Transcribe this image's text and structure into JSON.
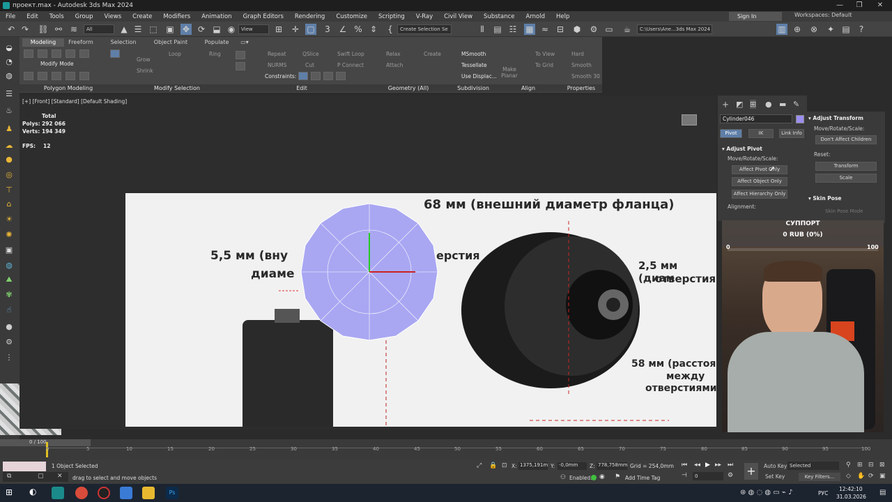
{
  "window": {
    "title": "проект.max - Autodesk 3ds Max 2024",
    "minimize": "—",
    "maximize": "❐",
    "close": "✕"
  },
  "menu": [
    "File",
    "Edit",
    "Tools",
    "Group",
    "Views",
    "Create",
    "Modifiers",
    "Animation",
    "Graph Editors",
    "Rendering",
    "Customize",
    "Scripting",
    "V-Ray",
    "Civil View",
    "Substance",
    "Arnold",
    "Help"
  ],
  "account": {
    "signin": "Sign In",
    "workspaces": "Workspaces: Default"
  },
  "toolbar": {
    "filter": "All",
    "view": "View",
    "selection_set": "Create Selection Se",
    "path": "C:\\Users\\Ane...3ds Max 2024"
  },
  "ribbon": {
    "tabs": [
      "Modeling",
      "Freeform",
      "Selection",
      "Object Paint",
      "Populate"
    ],
    "mode": "Modify Mode",
    "groups": [
      "Polygon Modeling",
      "Modify Selection",
      "Edit",
      "Geometry (All)",
      "Subdivision",
      "Align",
      "Properties"
    ],
    "items": {
      "grow": "Grow",
      "shrink": "Shrink",
      "loop": "Loop",
      "ring": "Ring",
      "repeat": "Repeat",
      "qslice": "QSlice",
      "swift_loop": "Swift Loop",
      "nurms": "NURMS",
      "cut": "Cut",
      "p_connect": "P Connect",
      "constraints": "Constraints:",
      "relax": "Relax",
      "create": "Create",
      "attach": "Attach",
      "msmooth": "MSmooth",
      "tessellate": "Tessellate",
      "use_displace": "Use Displac...",
      "make_planar": "Make Planar",
      "to_view": "To View",
      "to_grid": "To Grid",
      "hard": "Hard",
      "smooth": "Smooth",
      "smooth30": "Smooth 30"
    }
  },
  "viewport": {
    "label": "[+] [Front] [Standard] [Default Shading]",
    "stats": {
      "total": "Total",
      "polys_label": "Polys:",
      "polys": "292 066",
      "verts_label": "Verts:",
      "verts": "194 349",
      "fps_label": "FPS:",
      "fps": "12"
    }
  },
  "image_text": {
    "flange": "68 мм (внешний диаметр фланца)",
    "inner1": "5,5 мм (вну",
    "inner2": "диаме",
    "hole_word": "ерстия",
    "hole_d1": "2,5 мм (диам",
    "hole_d2": "отверстия",
    "dist1": "58 мм (расстоя",
    "dist2": "между",
    "dist3": "отверстиями"
  },
  "command_panel": {
    "object_name": "Cylinder046",
    "object_color": "#9b8ef0",
    "tabs": [
      "Pivot",
      "IK",
      "Link Info"
    ],
    "adjust_pivot": "Adjust Pivot",
    "move_rotate_scale": "Move/Rotate/Scale:",
    "buttons": [
      "Affect Pivot Only",
      "Affect Object Only",
      "Affect Hierarchy Only"
    ],
    "alignment": "Alignment:"
  },
  "rollout": {
    "adjust_transform": "Adjust Transform",
    "move_rotate_scale": "Move/Rotate/Scale:",
    "dont_affect": "Don't Affect Children",
    "reset": "Reset:",
    "transform": "Transform",
    "scale": "Scale",
    "skin_pose": "Skin Pose",
    "skin_pose_mode": "Skin Pose Mode"
  },
  "donation": {
    "title": "СУППОРТ",
    "amount": "0 RUB (0%)",
    "min": "0",
    "max": "100",
    "progress": 0
  },
  "timeline": {
    "frame": "0 / 100",
    "ticks": [
      "0",
      "5",
      "10",
      "15",
      "20",
      "25",
      "30",
      "35",
      "40",
      "45",
      "50",
      "55",
      "60",
      "65",
      "70",
      "75",
      "80",
      "85",
      "90",
      "95",
      "100"
    ]
  },
  "status": {
    "selected": "1 Object Selected",
    "hint": "drag to select and move objects",
    "x_label": "X:",
    "x": "1375,191m",
    "y_label": "Y:",
    "y": "-0,0mm",
    "z_label": "Z:",
    "z": "778,758mm",
    "grid": "Grid = 254,0mm",
    "enabled": "Enabled:",
    "add_time_tag": "Add Time Tag",
    "auto_key": "Auto Key",
    "selected_dd": "Selected",
    "set_key": "Set Key",
    "key_filters": "Key Filters...",
    "frame_field": "0"
  },
  "taskbar": {
    "lang": "РУС",
    "time": "12:42:10",
    "date": "31.03.2026"
  }
}
